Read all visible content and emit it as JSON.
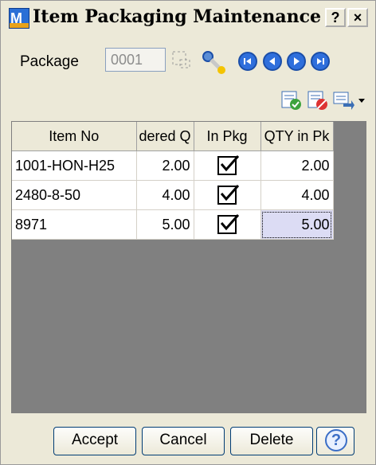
{
  "window": {
    "title": "Item Packaging Maintenance",
    "help_button": "?",
    "close_button": "×"
  },
  "package": {
    "label": "Package",
    "value": "0001"
  },
  "grid": {
    "columns": [
      "Item No",
      "dered Q",
      "In Pkg",
      "QTY in Pk"
    ],
    "rows": [
      {
        "item_no": "1001-HON-H25",
        "ordered": "2.00",
        "in_pkg": true,
        "qty": "2.00"
      },
      {
        "item_no": "2480-8-50",
        "ordered": "4.00",
        "in_pkg": true,
        "qty": "4.00"
      },
      {
        "item_no": "8971",
        "ordered": "5.00",
        "in_pkg": true,
        "qty": "5.00"
      }
    ]
  },
  "buttons": {
    "accept": "Accept",
    "cancel": "Cancel",
    "delete": "Delete",
    "help": "?"
  },
  "colors": {
    "accent": "#2f6fdc",
    "selected_cell": "#dcdcf4"
  },
  "icons": [
    "lookup-icon",
    "key-icon",
    "first-record-icon",
    "previous-record-icon",
    "next-record-icon",
    "last-record-icon",
    "select-all-icon",
    "clear-all-icon",
    "print-icon",
    "dropdown-icon",
    "help-icon"
  ]
}
